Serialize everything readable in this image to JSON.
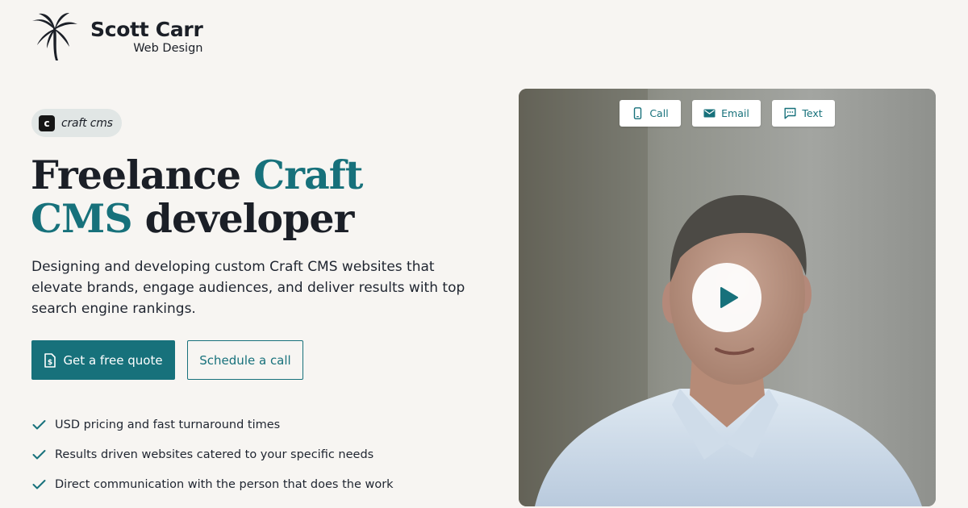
{
  "brand": {
    "name": "Scott Carr",
    "tagline": "Web Design",
    "logo_icon": "palm-tree-icon"
  },
  "badge": {
    "icon_letter": "c",
    "label": "craft cms"
  },
  "hero": {
    "headline_part1": "Freelance ",
    "headline_accent1": "Craft",
    "headline_accent2": "CMS",
    "headline_part2": " developer",
    "subtitle": "Designing and developing custom Craft CMS websites that elevate brands, engage audiences, and deliver results with top search engine rankings."
  },
  "buttons": {
    "primary_label": "Get a free quote",
    "primary_icon": "dollar-document-icon",
    "secondary_label": "Schedule a call"
  },
  "checklist": [
    "USD pricing and fast turnaround times",
    "Results driven websites catered to your specific needs",
    "Direct communication with the person that does the work"
  ],
  "video": {
    "contact_buttons": [
      {
        "label": "Call",
        "icon": "phone-icon"
      },
      {
        "label": "Email",
        "icon": "envelope-icon"
      },
      {
        "label": "Text",
        "icon": "chat-bubble-icon"
      }
    ],
    "play_icon": "play-icon"
  },
  "colors": {
    "accent": "#17717b",
    "background": "#f7f5f2",
    "text": "#1b1f27",
    "badge_bg": "#e1e6e5"
  }
}
